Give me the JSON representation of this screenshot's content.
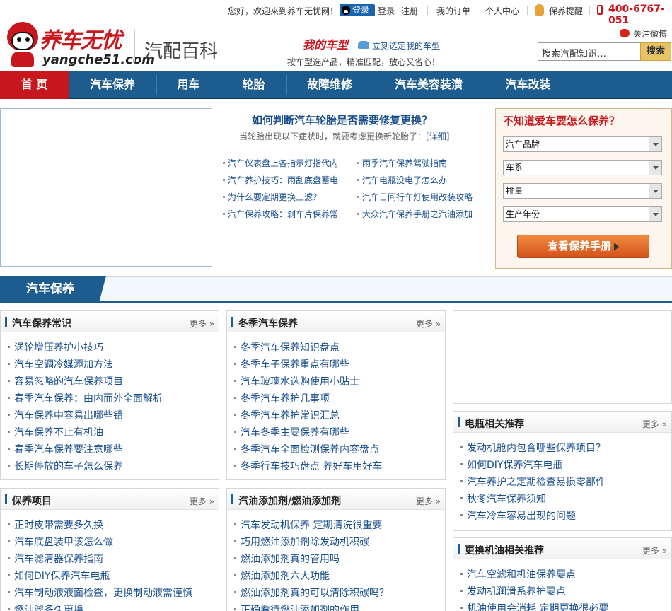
{
  "topbar": {
    "welcome": "您好，欢迎来到养车无忧网！",
    "login": "登录",
    "login_link": "登录",
    "register": "注册",
    "my_orders": "我的订单",
    "personal_center": "个人中心",
    "maintenance_reminder": "保养提醒",
    "phone": "400-6767-051"
  },
  "header": {
    "logo_cn": "养车无忧",
    "logo_en": "yangche51.com",
    "site_section": "汽配百科",
    "mycar_title": "我的车型",
    "mycar_link": "立刻选定我的车型",
    "mycar_desc": "按车型选产品，精准匹配，放心又省心！",
    "weibo": "关注微博",
    "search_placeholder": "搜索汽配知识…",
    "search_button": "搜索"
  },
  "nav": {
    "tabs": [
      "首 页",
      "汽车保养",
      "用车",
      "轮胎",
      "故障维修",
      "汽车美容装潢",
      "汽车改装"
    ]
  },
  "feature": {
    "title": "如何判断汽车轮胎是否需要修复更换？",
    "subtitle": "当轮胎出现以下症状时，就要考虑更换新轮胎了：",
    "detail": "[详细]",
    "links": [
      "汽车仪表盘上各指示灯指代内",
      "雨季汽车保养驾驶指南",
      "汽车养护技巧：雨刮底盘蓄电",
      "汽车电瓶没电了怎么办",
      "为什么要定期更换三滤？",
      "汽车日间行车灯使用改装攻略",
      "汽车保养攻略：刹车片保养常",
      "大众汽车保养手册之汽油添加"
    ]
  },
  "manual_box": {
    "title": "不知道爱车要怎么保养？",
    "selects": [
      "汽车品牌",
      "车系",
      "排量",
      "生产年份"
    ],
    "button": "查看保养手册"
  },
  "section": {
    "title": "汽车保养"
  },
  "panels": {
    "more": "更多 »",
    "maintenance_tips": {
      "title": "汽车保养常识",
      "items": [
        "涡轮增压养护小技巧",
        "汽车空调冷媒添加方法",
        "容易忽略的汽车保养项目",
        "春季汽车保养：由内而外全面解析",
        "汽车保养中容易出哪些错",
        "汽车保养不止有机油",
        "春季汽车保养要注意哪些",
        "长期停放的车子怎么保养"
      ]
    },
    "winter": {
      "title": "冬季汽车保养",
      "items": [
        "冬季汽车保养知识盘点",
        "冬季车子保养重点有哪些",
        "汽车玻璃水选购使用小贴士",
        "冬季汽车养护几事项",
        "冬季汽车养护常识汇总",
        "汽车冬季主要保养有哪些",
        "冬季汽车全面检测保养内容盘点",
        "冬季行车技巧盘点 养好车用好车"
      ]
    },
    "battery": {
      "title": "电瓶相关推荐",
      "items": [
        "发动机舱内包含哪些保养项目？",
        "如何DIY保养汽车电瓶",
        "汽车养护之定期检查易损零部件",
        "秋冬汽车保养须知",
        "汽车冷车容易出现的问题"
      ]
    },
    "items": {
      "title": "保养项目",
      "items": [
        "正时皮带需要多久换",
        "汽车底盘装甲该怎么做",
        "汽车滤清器保养指南",
        "如何DIY保养汽车电瓶",
        "汽车制动液液面检查，更换制动液需谨慎",
        "燃油滤多久更换"
      ]
    },
    "fuel_additive": {
      "title": "汽油添加剂/燃油添加剂",
      "items": [
        "汽车发动机保养 定期清洗很重要",
        "巧用燃油添加剂除发动机积碳",
        "燃油添加剂真的管用吗",
        "燃油添加剂六大功能",
        "燃油添加剂真的可以清除积碳吗？",
        "正确看待燃油添加剂的作用"
      ]
    },
    "oil": {
      "title": "更换机油相关推荐",
      "items": [
        "汽车空滤和机油保养要点",
        "发动机润滑系养护要点",
        "机油使用会消耗 定期更换很必要"
      ]
    }
  },
  "colors": {
    "brand_red": "#c8161d",
    "nav_blue": "#1d5c8f",
    "link_blue": "#1a4e8c",
    "button_orange": "#e0692a"
  }
}
